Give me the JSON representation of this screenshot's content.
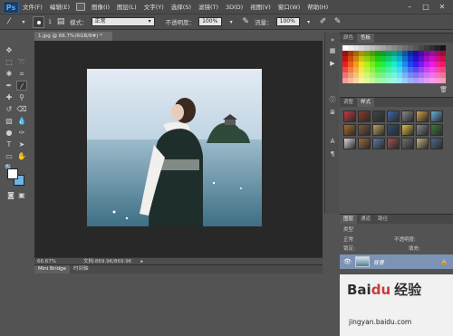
{
  "menubar": {
    "logo": "Ps",
    "items": [
      "文件(F)",
      "编辑(E)",
      "图像(I)",
      "图层(L)",
      "文字(Y)",
      "选择(S)",
      "滤镜(T)",
      "3D(D)",
      "视图(V)",
      "窗口(W)",
      "帮助(H)"
    ]
  },
  "options": {
    "brush_size": "1",
    "mode_label": "模式：",
    "mode_value": "正常",
    "opacity_label": "不透明度：",
    "opacity_value": "100%",
    "flow_label": "流量：",
    "flow_value": "100%"
  },
  "document": {
    "tab_title": "1.jpg @ 66.7%(RGB/8#) *",
    "zoom": "66.67%",
    "doc_size": "文档:869.9K/869.9K"
  },
  "bottom_panel": {
    "tabs": [
      "Mini Bridge",
      "时间轴"
    ]
  },
  "panels": {
    "swatches_tabs": [
      "颜色",
      "色板"
    ],
    "styles_tabs": [
      "调整",
      "样式"
    ],
    "layers_tabs": [
      "图层",
      "通道",
      "路径"
    ],
    "kind_label": "类型",
    "blend_mode": "正常",
    "opacity_label": "不透明度:",
    "lock_label": "锁定:",
    "fill_label": "填充:",
    "layer_name": "背景"
  },
  "watermark": {
    "logo": "Bai",
    "logo_du": "du",
    "logo_cn": "经验",
    "url": "jingyan.baidu.com"
  },
  "colors": {
    "foreground": "#ffffff",
    "background": "#6fb4e6",
    "accent": "#7d93b5",
    "ps_blue": "#59a9ff"
  }
}
